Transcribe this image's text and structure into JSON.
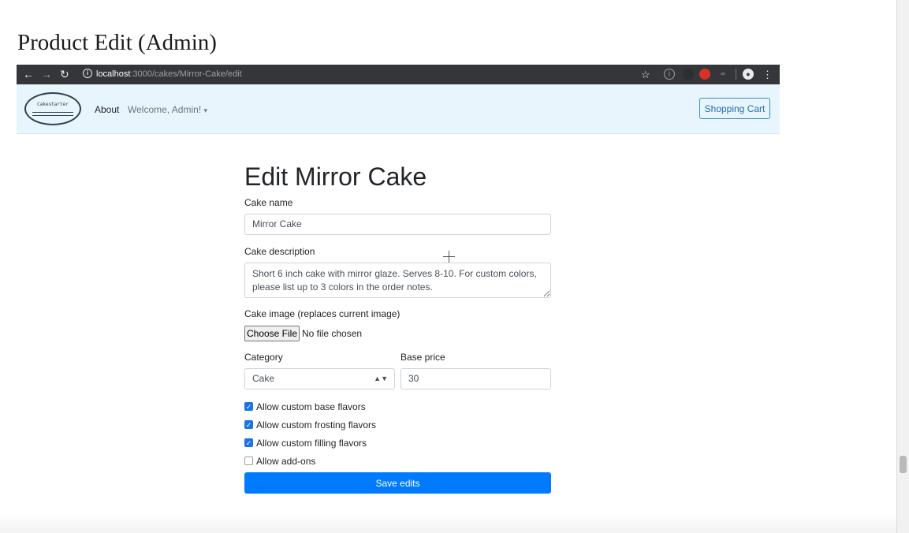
{
  "page": {
    "title": "Product Edit (Admin)"
  },
  "browser": {
    "url_host": "localhost",
    "url_path": ":3000/cakes/Mirror-Cake/edit",
    "icons": [
      "back-arrow-icon",
      "forward-arrow-icon",
      "reload-icon",
      "info-icon",
      "star-icon",
      "account-icon",
      "more-vert-icon"
    ]
  },
  "navbar": {
    "logo_text": "Cakestarter",
    "about": "About",
    "welcome": "Welcome, Admin!",
    "dropdown_caret": "▾",
    "cart_button": "Shopping Cart",
    "background": "#e8f5fc"
  },
  "form": {
    "heading": "Edit Mirror Cake",
    "name_label": "Cake name",
    "name_value": "Mirror Cake",
    "description_label": "Cake description",
    "description_value": "Short 6 inch cake with mirror glaze. Serves 8-10. For custom colors, please list up to 3 colors in the order notes.",
    "image_label": "Cake image (replaces current image)",
    "file_button": "Choose File",
    "file_status": "No file chosen",
    "category_label": "Category",
    "category_value": "Cake",
    "price_label": "Base price",
    "price_value": "30",
    "checkboxes": [
      {
        "label": "Allow custom base flavors",
        "checked": true
      },
      {
        "label": "Allow custom frosting flavors",
        "checked": true
      },
      {
        "label": "Allow custom filling flavors",
        "checked": true
      },
      {
        "label": "Allow add-ons",
        "checked": false
      }
    ],
    "check_mark": "✓",
    "save_button": "Save edits",
    "primary_color": "#007bff"
  }
}
